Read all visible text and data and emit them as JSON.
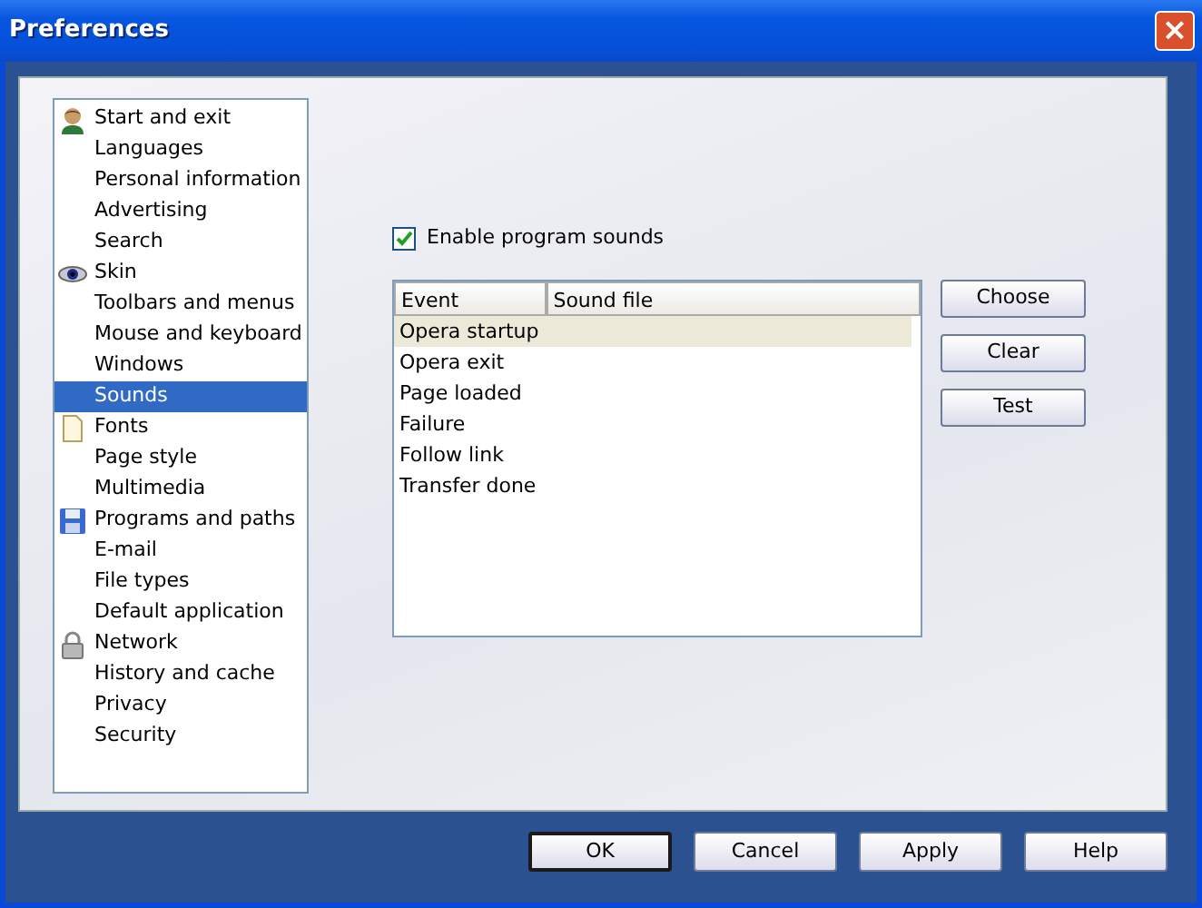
{
  "window": {
    "title": "Preferences",
    "close": "×"
  },
  "sidebar": {
    "items": [
      {
        "label": "Start and exit",
        "kind": "section",
        "selected": false
      },
      {
        "label": "Languages",
        "kind": "page",
        "selected": false
      },
      {
        "label": "Personal information",
        "kind": "page",
        "selected": false
      },
      {
        "label": "Advertising",
        "kind": "page",
        "selected": false
      },
      {
        "label": "Search",
        "kind": "page",
        "selected": false
      },
      {
        "label": "Skin",
        "kind": "section",
        "selected": false
      },
      {
        "label": "Toolbars and menus",
        "kind": "page",
        "selected": false
      },
      {
        "label": "Mouse and keyboard",
        "kind": "page",
        "selected": false
      },
      {
        "label": "Windows",
        "kind": "page",
        "selected": false
      },
      {
        "label": "Sounds",
        "kind": "page",
        "selected": true
      },
      {
        "label": "Fonts",
        "kind": "section",
        "selected": false
      },
      {
        "label": "Page style",
        "kind": "page",
        "selected": false
      },
      {
        "label": "Multimedia",
        "kind": "page",
        "selected": false
      },
      {
        "label": "Programs and paths",
        "kind": "section",
        "selected": false
      },
      {
        "label": "E-mail",
        "kind": "page",
        "selected": false
      },
      {
        "label": "File types",
        "kind": "page",
        "selected": false
      },
      {
        "label": "Default application",
        "kind": "page",
        "selected": false
      },
      {
        "label": "Network",
        "kind": "section",
        "selected": false
      },
      {
        "label": "History and cache",
        "kind": "page",
        "selected": false
      },
      {
        "label": "Privacy",
        "kind": "page",
        "selected": false
      },
      {
        "label": "Security",
        "kind": "page",
        "selected": false
      }
    ]
  },
  "enable_sounds": {
    "label": "Enable program sounds",
    "checked": true
  },
  "table": {
    "columns": [
      "Event",
      "Sound file"
    ],
    "rows": [
      {
        "event": "Opera startup",
        "selected": true
      },
      {
        "event": "Opera exit",
        "selected": false
      },
      {
        "event": "Page loaded",
        "selected": false
      },
      {
        "event": "Failure",
        "selected": false
      },
      {
        "event": "Follow link",
        "selected": false
      },
      {
        "event": "Transfer done",
        "selected": false
      }
    ]
  },
  "side_buttons": [
    "Choose",
    "Clear",
    "Test"
  ],
  "buttons": [
    {
      "label": "OK",
      "default": true
    },
    {
      "label": "Cancel",
      "default": false
    },
    {
      "label": "Apply",
      "default": false
    },
    {
      "label": "Help",
      "default": false
    }
  ]
}
